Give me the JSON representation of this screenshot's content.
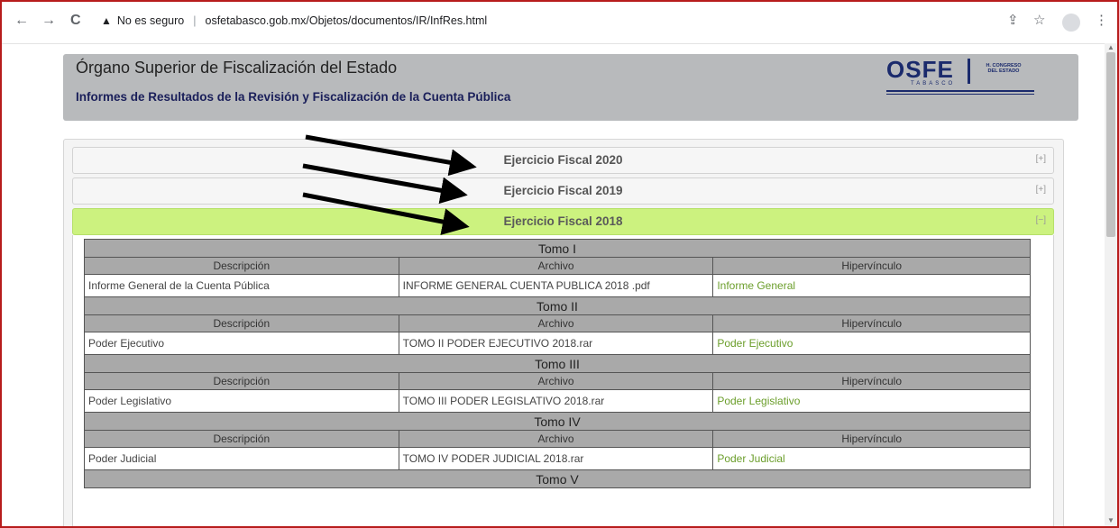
{
  "browser": {
    "back_icon": "←",
    "forward_icon": "→",
    "reload_icon": "C",
    "security_icon": "▲",
    "security_text": "No es seguro",
    "url": "osfetabasco.gob.mx/Objetos/documentos/IR/InfRes.html",
    "share_icon": "⇪",
    "star_icon": "☆",
    "menu_icon": "⋮"
  },
  "header": {
    "org_name": "Órgano Superior de Fiscalización del Estado",
    "subtitle": "Informes de Resultados de la Revisión y Fiscalización de la Cuenta Pública",
    "logo_text": "OSFE",
    "logo_sub": "TABASCO",
    "logo_congreso": "H. CONGRESO DEL ESTADO"
  },
  "accordion": [
    {
      "label": "Ejercicio Fiscal 2020",
      "toggle": "[+]",
      "open": false
    },
    {
      "label": "Ejercicio Fiscal 2019",
      "toggle": "[+]",
      "open": false
    },
    {
      "label": "Ejercicio Fiscal 2018",
      "toggle": "[−]",
      "open": true
    }
  ],
  "columns": {
    "descripcion": "Descripción",
    "archivo": "Archivo",
    "hipervinculo": "Hipervínculo"
  },
  "tomes": [
    {
      "title": "Tomo I",
      "descripcion": "Informe General de la Cuenta Pública",
      "archivo": "INFORME GENERAL CUENTA PUBLICA 2018 .pdf",
      "link": "Informe General"
    },
    {
      "title": "Tomo II",
      "descripcion": "Poder Ejecutivo",
      "archivo": "TOMO II PODER EJECUTIVO 2018.rar",
      "link": "Poder Ejecutivo"
    },
    {
      "title": "Tomo III",
      "descripcion": "Poder Legislativo",
      "archivo": "TOMO III PODER LEGISLATIVO 2018.rar",
      "link": "Poder Legislativo"
    },
    {
      "title": "Tomo IV",
      "descripcion": "Poder Judicial",
      "archivo": "TOMO IV PODER JUDICIAL 2018.rar",
      "link": "Poder Judicial"
    },
    {
      "title": "Tomo V"
    }
  ],
  "colors": {
    "accent_open": "#ccf27f",
    "link": "#6b9e2b",
    "table_header": "#a9a9a9"
  }
}
